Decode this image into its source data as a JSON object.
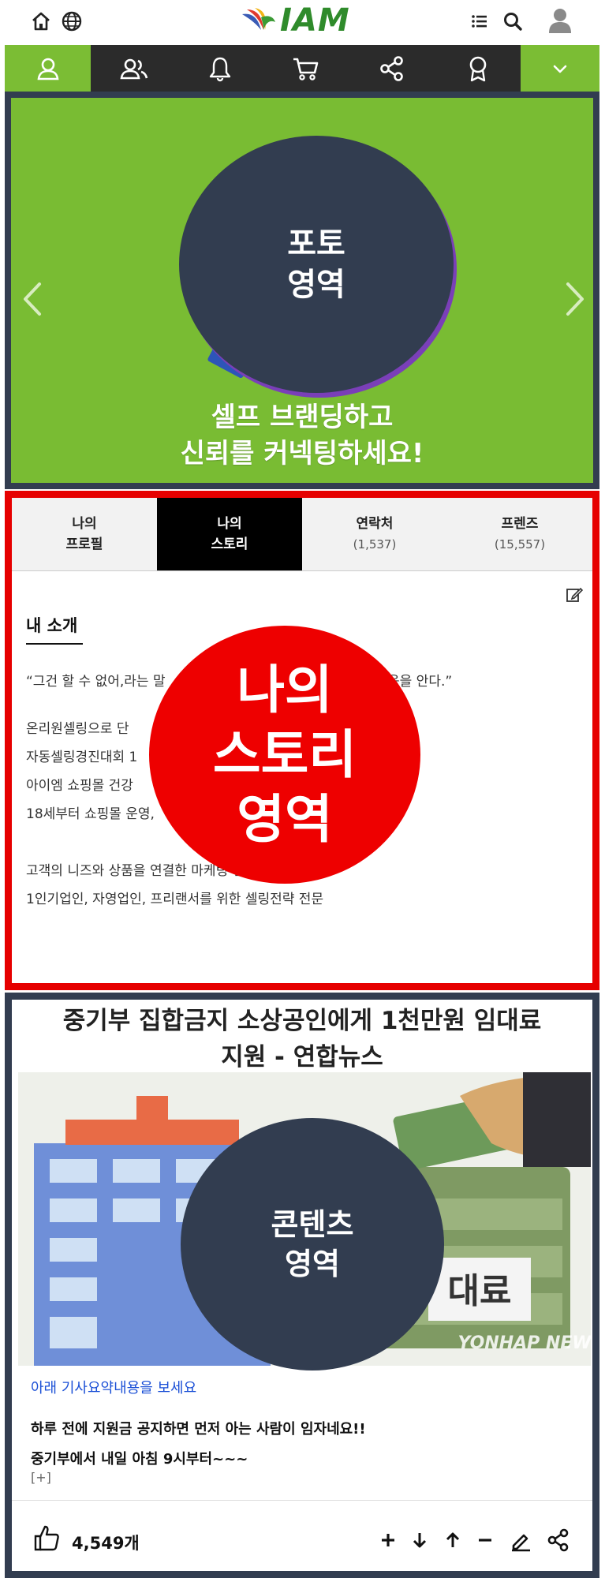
{
  "logo": {
    "text": "IAM"
  },
  "colors": {
    "brand_green": "#7bbd34",
    "dark_navy": "#323d50",
    "nav_bg": "#2b2b2b",
    "story_red": "#e60000",
    "link_blue": "#1a4fd6"
  },
  "topbar": {
    "left_icons": [
      "home-icon",
      "globe-icon"
    ],
    "right_icons": [
      "list-icon",
      "search-icon",
      "user-icon"
    ]
  },
  "nav": {
    "items": [
      {
        "icon": "person-icon",
        "active": true
      },
      {
        "icon": "people-icon",
        "active": false
      },
      {
        "icon": "bell-icon",
        "active": false
      },
      {
        "icon": "cart-icon",
        "active": false
      },
      {
        "icon": "share-icon",
        "active": false
      },
      {
        "icon": "award-icon",
        "active": false
      }
    ],
    "more_icon": "chevron-down-icon"
  },
  "photo": {
    "overlay_line1": "포토",
    "overlay_line2": "영역",
    "slogan_line1": "셀프 브랜딩하고",
    "slogan_line2": "신뢰를 커넥팅하세요!"
  },
  "story": {
    "tabs": [
      {
        "line1": "나의",
        "line2": "프로필",
        "active": false
      },
      {
        "line1": "나의",
        "line2": "스토리",
        "active": true
      },
      {
        "line1": "연락처",
        "line2": "(1,537)",
        "active": false
      },
      {
        "line1": "프렌즈",
        "line2": "(15,557)",
        "active": false
      }
    ],
    "intro_title": "내 소개",
    "intro_quote_left": "“그건 할 수 없어,라는 말",
    "intro_quote_right": "음을 안다.”",
    "intro_lines": [
      "온리원셀링으로 단",
      "자동셀링경진대회 1",
      "아이엠 쇼핑몰 건강",
      "18세부터 쇼핑몰 운영,"
    ],
    "intro_lines2": [
      "고객의 니즈와 상품을 연결한 마케팅 전문",
      "1인기업인, 자영업인, 프리랜서를 위한 셀링전략 전문"
    ],
    "overlay_line1": "나의",
    "overlay_line2": "스토리",
    "overlay_line3": "영역"
  },
  "content": {
    "news_title_line1": "중기부 집합금지 소상공인에게 1천만원 임대료",
    "news_title_line2": "지원 - 연합뉴스",
    "image_sign": "대료",
    "image_watermark": "YONHAP NEWS",
    "overlay_line1": "콘텐츠",
    "overlay_line2": "영역",
    "summary_link": "아래 기사요약내용을 보세요",
    "summary_line1": "하루 전에 지원금 공지하면 먼저 아는 사람이 임자네요!!",
    "summary_line2": "중기부에서 내일 아침 9시부터~~~",
    "expand_label": "[+]",
    "like_count": "4,549개",
    "actions": [
      "plus-icon",
      "arrow-down-icon",
      "arrow-up-icon",
      "minus-icon",
      "pencil-icon",
      "share-icon"
    ]
  }
}
